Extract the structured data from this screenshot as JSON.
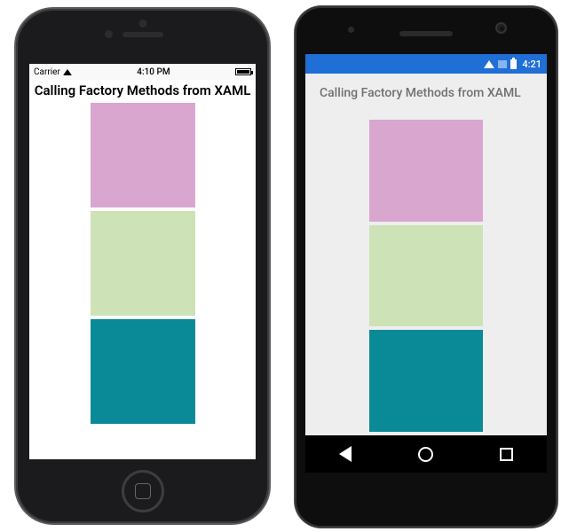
{
  "ios": {
    "status": {
      "carrier": "Carrier",
      "time": "4:10 PM"
    },
    "title": "Calling Factory Methods from XAML"
  },
  "android": {
    "status": {
      "time": "4:21"
    },
    "title": "Calling Factory Methods from XAML"
  },
  "colors": {
    "swatch1": "#d9a6cf",
    "swatch2": "#cde2b6",
    "swatch3": "#098a96"
  }
}
